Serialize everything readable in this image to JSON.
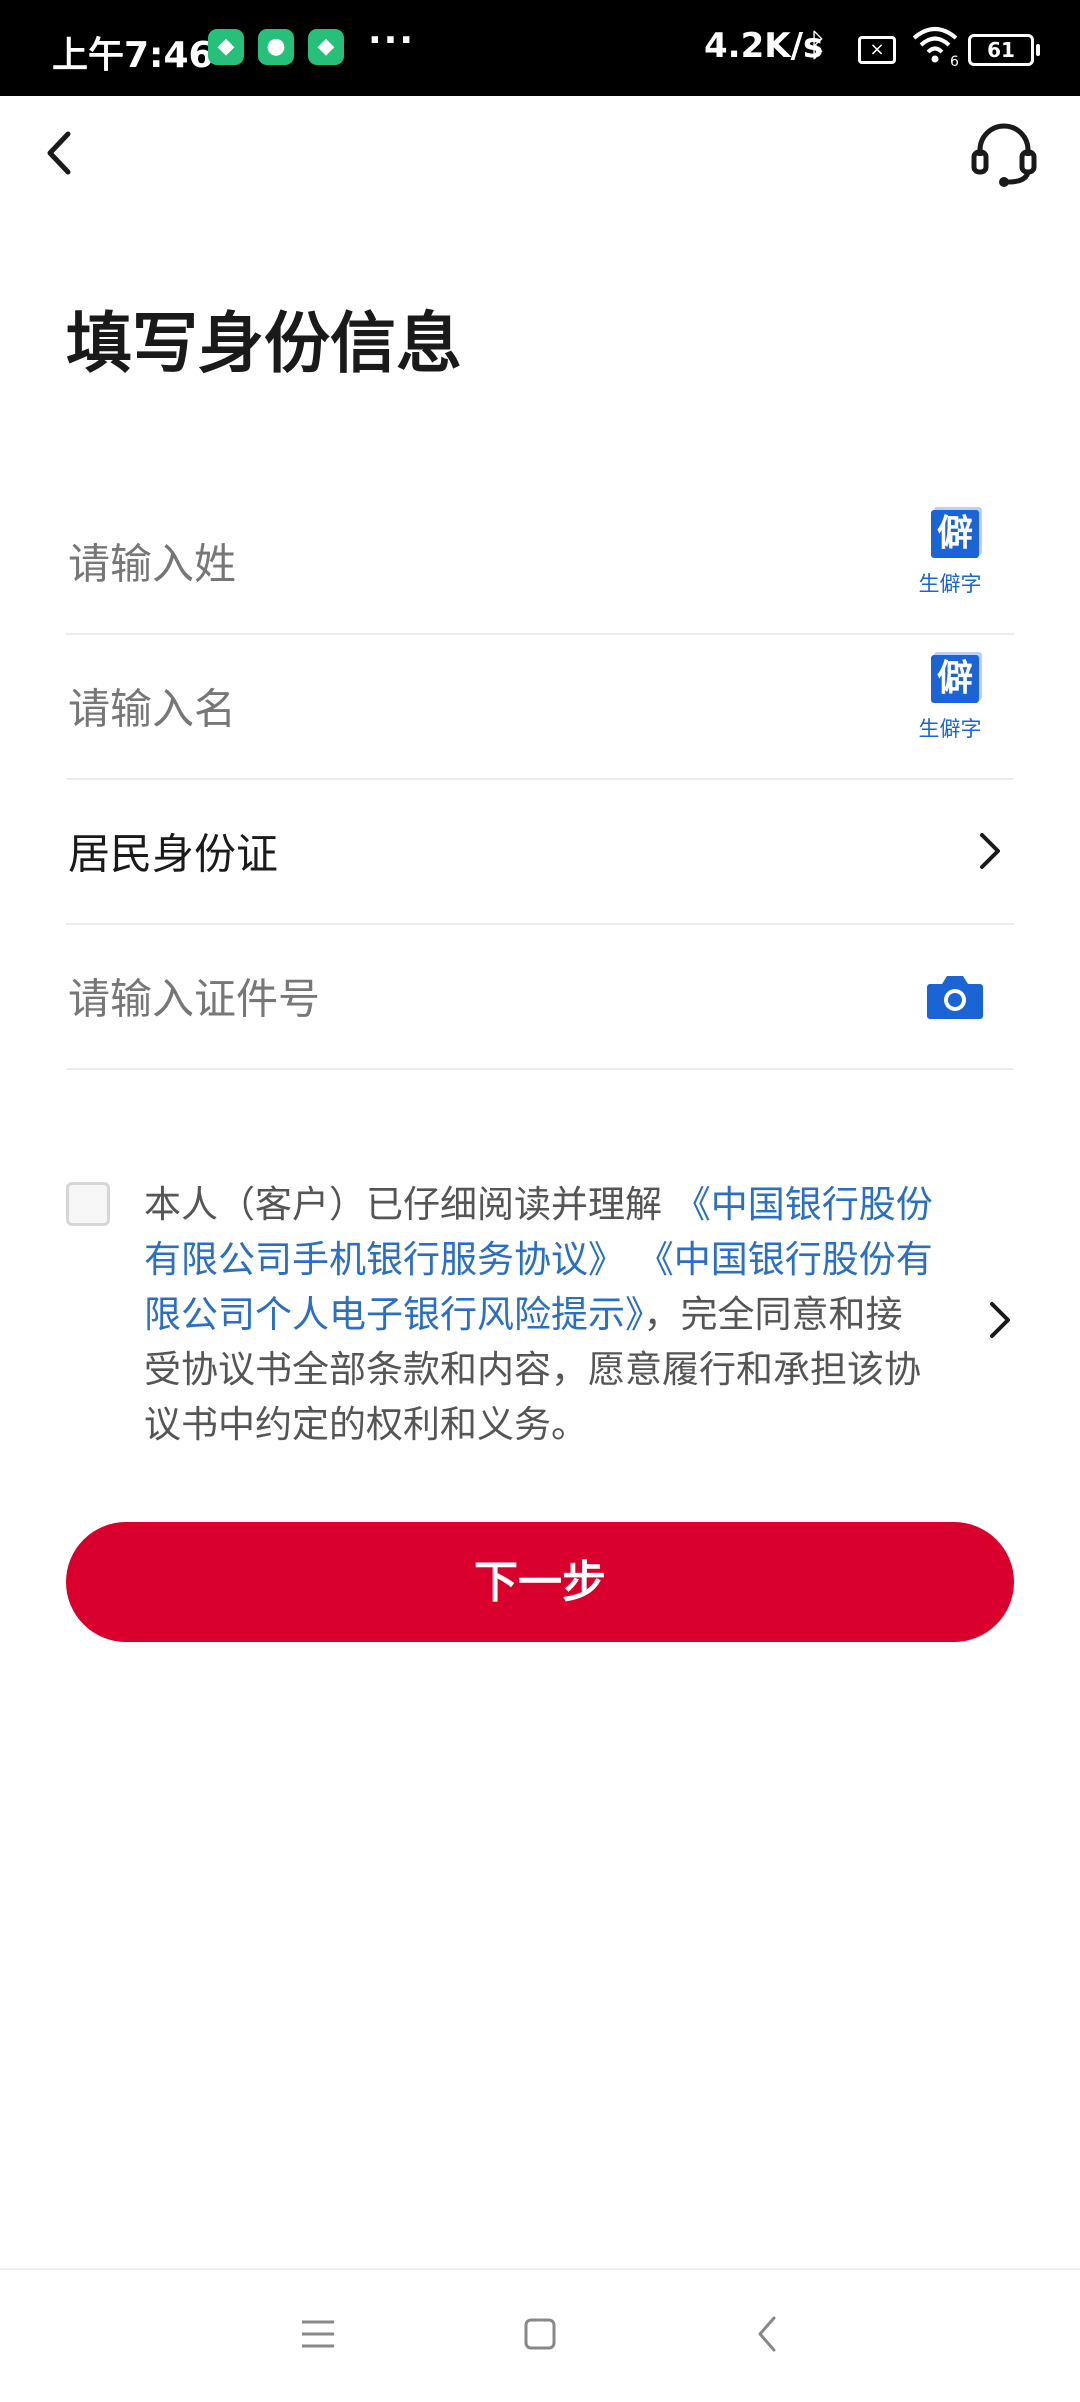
{
  "status_bar": {
    "time": "上午7:46",
    "network_speed": "4.2K/s",
    "battery": "61",
    "more": "···",
    "wifi_badge": "6"
  },
  "header": {
    "back_icon": "chevron-left-icon",
    "support_icon": "headset-icon"
  },
  "page": {
    "title": "填写身份信息"
  },
  "form": {
    "surname": {
      "placeholder": "请输入姓",
      "rare_char_label": "生僻字",
      "rare_char_glyph": "僻"
    },
    "given_name": {
      "placeholder": "请输入名",
      "rare_char_label": "生僻字",
      "rare_char_glyph": "僻"
    },
    "id_type": {
      "value": "居民身份证"
    },
    "id_number": {
      "placeholder": "请输入证件号",
      "camera_icon": "camera-icon"
    }
  },
  "agreement": {
    "prefix": "本人（客户）已仔细阅读并理解",
    "link1": "《中国银行股份有限公司手机银行服务协议》",
    "link2": "《中国银行股份有限公司个人电子银行风险提示》",
    "suffix": "，完全同意和接受协议书全部条款和内容，愿意履行和承担该协议书中约定的权利和义务。"
  },
  "actions": {
    "next_label": "下一步"
  },
  "colors": {
    "accent_red": "#d9002e",
    "link_blue": "#2a6fc4",
    "icon_blue": "#1a64d6"
  }
}
